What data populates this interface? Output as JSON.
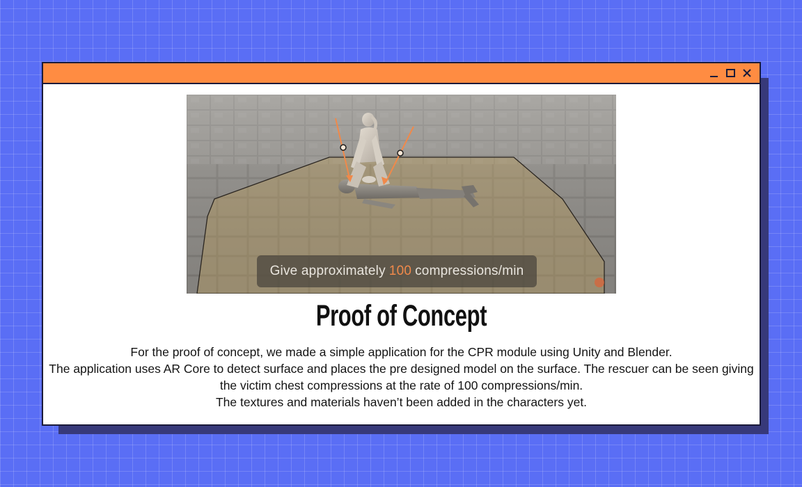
{
  "window": {
    "controls": {
      "minimize": "minimize-icon",
      "maximize": "maximize-icon",
      "close": "close-icon"
    },
    "accent_color": "#ff8c42",
    "background_color": "#5a6ef5"
  },
  "scene": {
    "caption_before": "Give approximately",
    "caption_number": "100",
    "caption_after": "compressions/min",
    "highlight_color": "#f0894a"
  },
  "content": {
    "title": "Proof of Concept",
    "paragraphs": [
      "For the proof of concept, we made a simple application for the CPR module using Unity and Blender.",
      "The application uses AR Core to detect surface and places the pre designed model on the surface. The rescuer can be seen giving the victim chest compressions at the rate of 100 compressions/min.",
      "The textures and materials haven’t been added in the characters yet."
    ]
  }
}
